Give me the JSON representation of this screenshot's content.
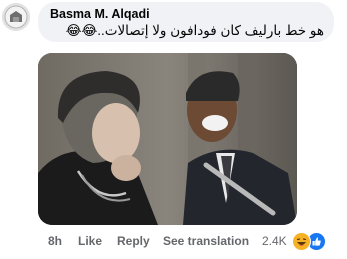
{
  "comment": {
    "author": "Basma M. Alqadi",
    "text": "هو خط بارليف كان فودافون ولا إتصالات..😂😂"
  },
  "photo": {
    "alt": "Two people laughing"
  },
  "actions": {
    "time": "8h",
    "like": "Like",
    "reply": "Reply",
    "translate": "See translation"
  },
  "reactions": {
    "count": "2.4K",
    "icons": [
      "haha-icon",
      "like-icon"
    ]
  },
  "colors": {
    "bubble": "#f0f2f5",
    "meta_text": "#65676b",
    "like_blue": "#1877f2",
    "haha_yellow": "#f7b125"
  }
}
